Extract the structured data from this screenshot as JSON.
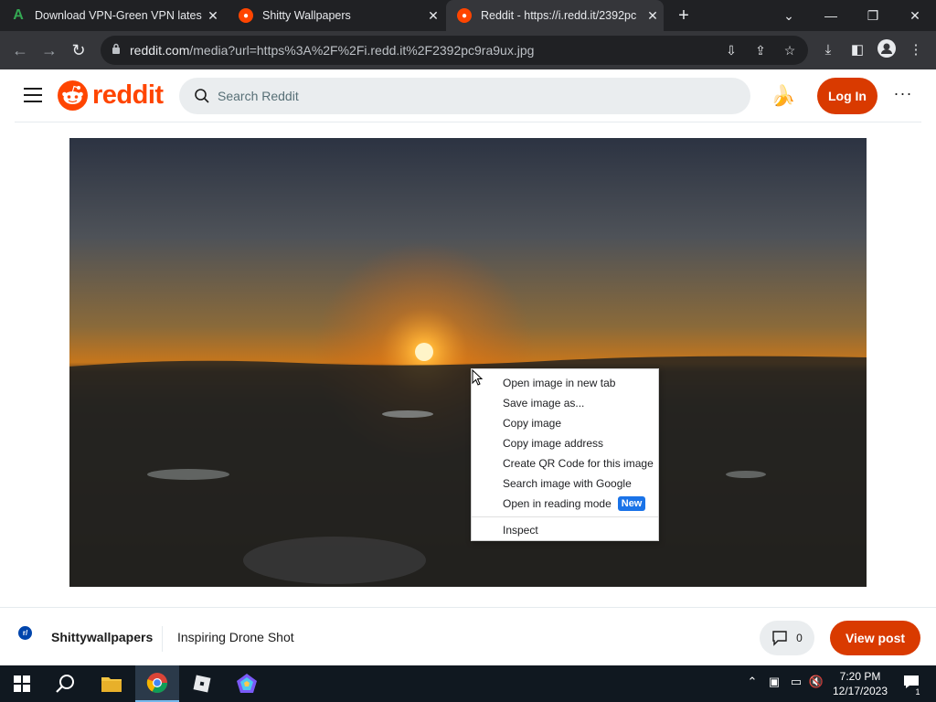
{
  "browser": {
    "tabs": [
      {
        "title": "Download VPN-Green VPN lates",
        "close": "✕"
      },
      {
        "title": "Shitty Wallpapers",
        "close": "✕"
      },
      {
        "title": "Reddit - https://i.redd.it/2392pc",
        "close": "✕"
      }
    ],
    "new_tab": "+",
    "url_host": "reddit.com",
    "url_rest": "/media?url=https%3A%2F%2Fi.redd.it%2F2392pc9ra9ux.jpg"
  },
  "reddit": {
    "logo_text": "reddit",
    "search_placeholder": "Search Reddit",
    "login_label": "Log In",
    "more_label": "···"
  },
  "image": {
    "alt": "Sunset over a landscape"
  },
  "context_menu": {
    "items": [
      "Open image in new tab",
      "Save image as...",
      "Copy image",
      "Copy image address",
      "Create QR Code for this image",
      "Search image with Google",
      "Open in reading mode"
    ],
    "new_badge": "New",
    "inspect": "Inspect"
  },
  "post": {
    "subreddit_badge": "r/",
    "subreddit": "Shittywallpapers",
    "title": "Inspiring Drone Shot",
    "comment_count": "0",
    "view_post": "View post"
  },
  "taskbar": {
    "time": "7:20 PM",
    "date": "12/17/2023",
    "notif_count": "1"
  },
  "colors": {
    "reddit_orange": "#ff4500",
    "login_bg": "#d93a00",
    "chrome_dark": "#202124",
    "chrome_toolbar": "#35363a",
    "badge_blue": "#1a73e8"
  }
}
